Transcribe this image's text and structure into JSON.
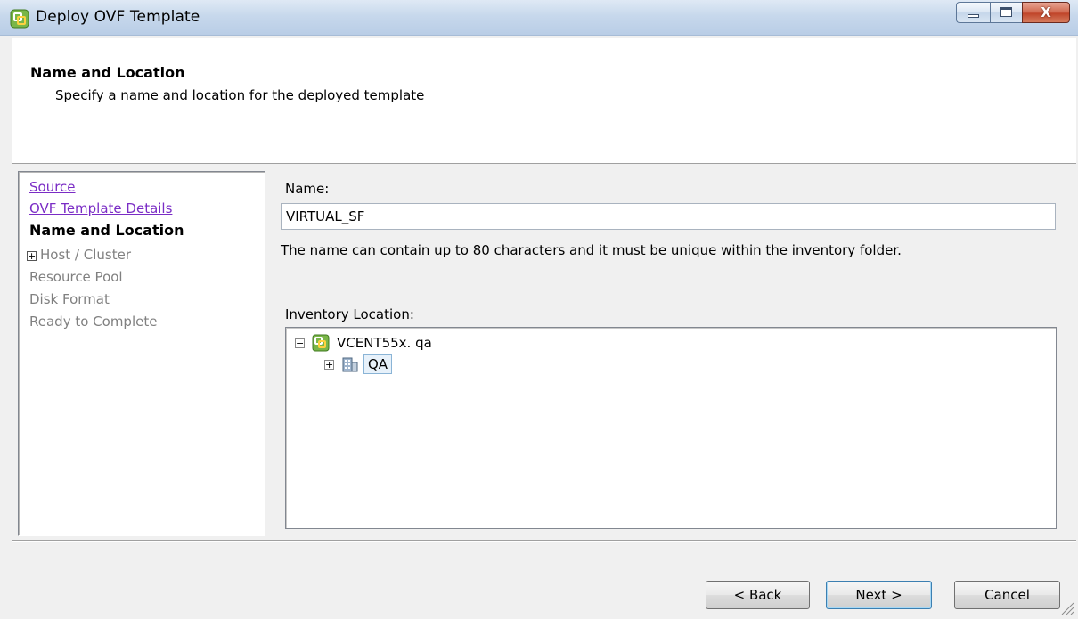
{
  "window": {
    "title": "Deploy OVF Template",
    "controls": {
      "minimize": "minimize",
      "maximize": "maximize",
      "close": "X"
    }
  },
  "header": {
    "title": "Name and Location",
    "subtitle": "Specify a name and location for the deployed template"
  },
  "steps": [
    {
      "label": "Source",
      "state": "visited"
    },
    {
      "label": "OVF Template Details",
      "state": "visited"
    },
    {
      "label": "Name and Location",
      "state": "current"
    },
    {
      "label": "Host / Cluster",
      "state": "pending",
      "expandable": true,
      "expander": "+"
    },
    {
      "label": "Resource Pool",
      "state": "pending"
    },
    {
      "label": "Disk Format",
      "state": "pending"
    },
    {
      "label": "Ready to Complete",
      "state": "pending"
    }
  ],
  "form": {
    "name_label": "Name:",
    "name_value": "VIRTUAL_SF",
    "name_hint": "The name can contain up to 80 characters and it must be unique within the inventory folder.",
    "inventory_label": "Inventory Location:"
  },
  "tree": {
    "root": {
      "label": "VCENT55x. qa",
      "expander": "−",
      "icon": "vcenter-icon"
    },
    "child": {
      "label": "QA",
      "expander": "+",
      "icon": "datacenter-icon",
      "selected": true
    }
  },
  "buttons": {
    "back": "< Back",
    "next": "Next >",
    "cancel": "Cancel"
  },
  "colors": {
    "link_visited": "#7a2cc5",
    "disabled_text": "#808080",
    "selection_bg": "#e7f1fa",
    "titlebar": "#c7d8ec",
    "close_button": "#c0452a"
  }
}
